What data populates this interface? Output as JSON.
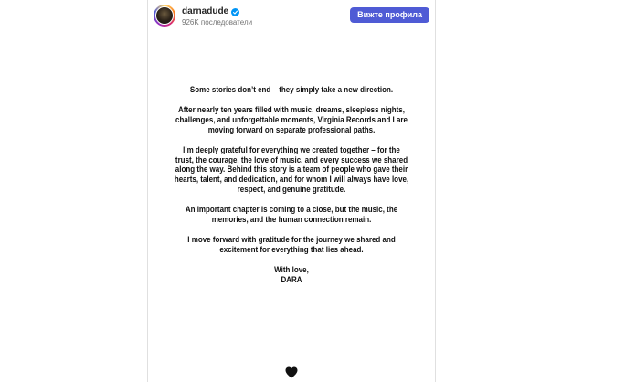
{
  "header": {
    "username": "darnadude",
    "followers": "926K последователи",
    "view_profile_label": "Вижте профила"
  },
  "post": {
    "paragraphs": [
      "Some stories don’t end – they simply take a new direction.",
      "After nearly ten years filled with music, dreams, sleepless nights, challenges, and unforgettable moments, Virginia Records and I are moving forward on separate professional paths.",
      "I’m deeply grateful for everything we created together – for the trust, the courage, the love of music, and every success we shared along the way. Behind this story is a team of people who gave their hearts, talent, and dedication, and for whom I will always have love, respect, and genuine gratitude.",
      "An important chapter is coming to a close, but the music, the memories, and the human connection remain.",
      "I move forward with gratitude for the journey we shared and excitement for everything that lies ahead."
    ],
    "signoff": "With love,",
    "signature": "DARA"
  },
  "icons": {
    "verified": "verified-badge-icon",
    "heart": "black-heart-icon"
  },
  "colors": {
    "button": "#4f5bd5",
    "verified": "#0095f6",
    "text": "#111111"
  }
}
